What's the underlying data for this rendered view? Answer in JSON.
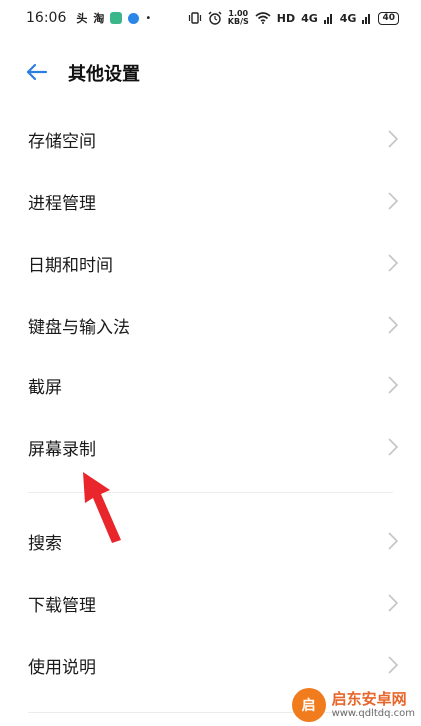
{
  "status_bar": {
    "time": "16:06",
    "app_icons": [
      "头",
      "淘"
    ],
    "dot": "•",
    "network_speed_value": "1.00",
    "network_speed_unit": "KB/S",
    "hd_label": "HD",
    "signal_1": "4G",
    "signal_2": "4G",
    "battery": "40"
  },
  "header": {
    "title": "其他设置"
  },
  "list_items": [
    {
      "label": "存储空间"
    },
    {
      "label": "进程管理"
    },
    {
      "label": "日期和时间"
    },
    {
      "label": "键盘与输入法"
    },
    {
      "label": "截屏"
    },
    {
      "label": "屏幕录制"
    },
    {
      "label": "搜索"
    },
    {
      "label": "下载管理"
    },
    {
      "label": "使用说明"
    }
  ],
  "colors": {
    "accent": "#2b7fe0",
    "annotation_arrow": "#e8262b"
  },
  "watermark": {
    "logo_text": "启",
    "name": "启东安卓网",
    "url": "www.qdltdq.com"
  }
}
